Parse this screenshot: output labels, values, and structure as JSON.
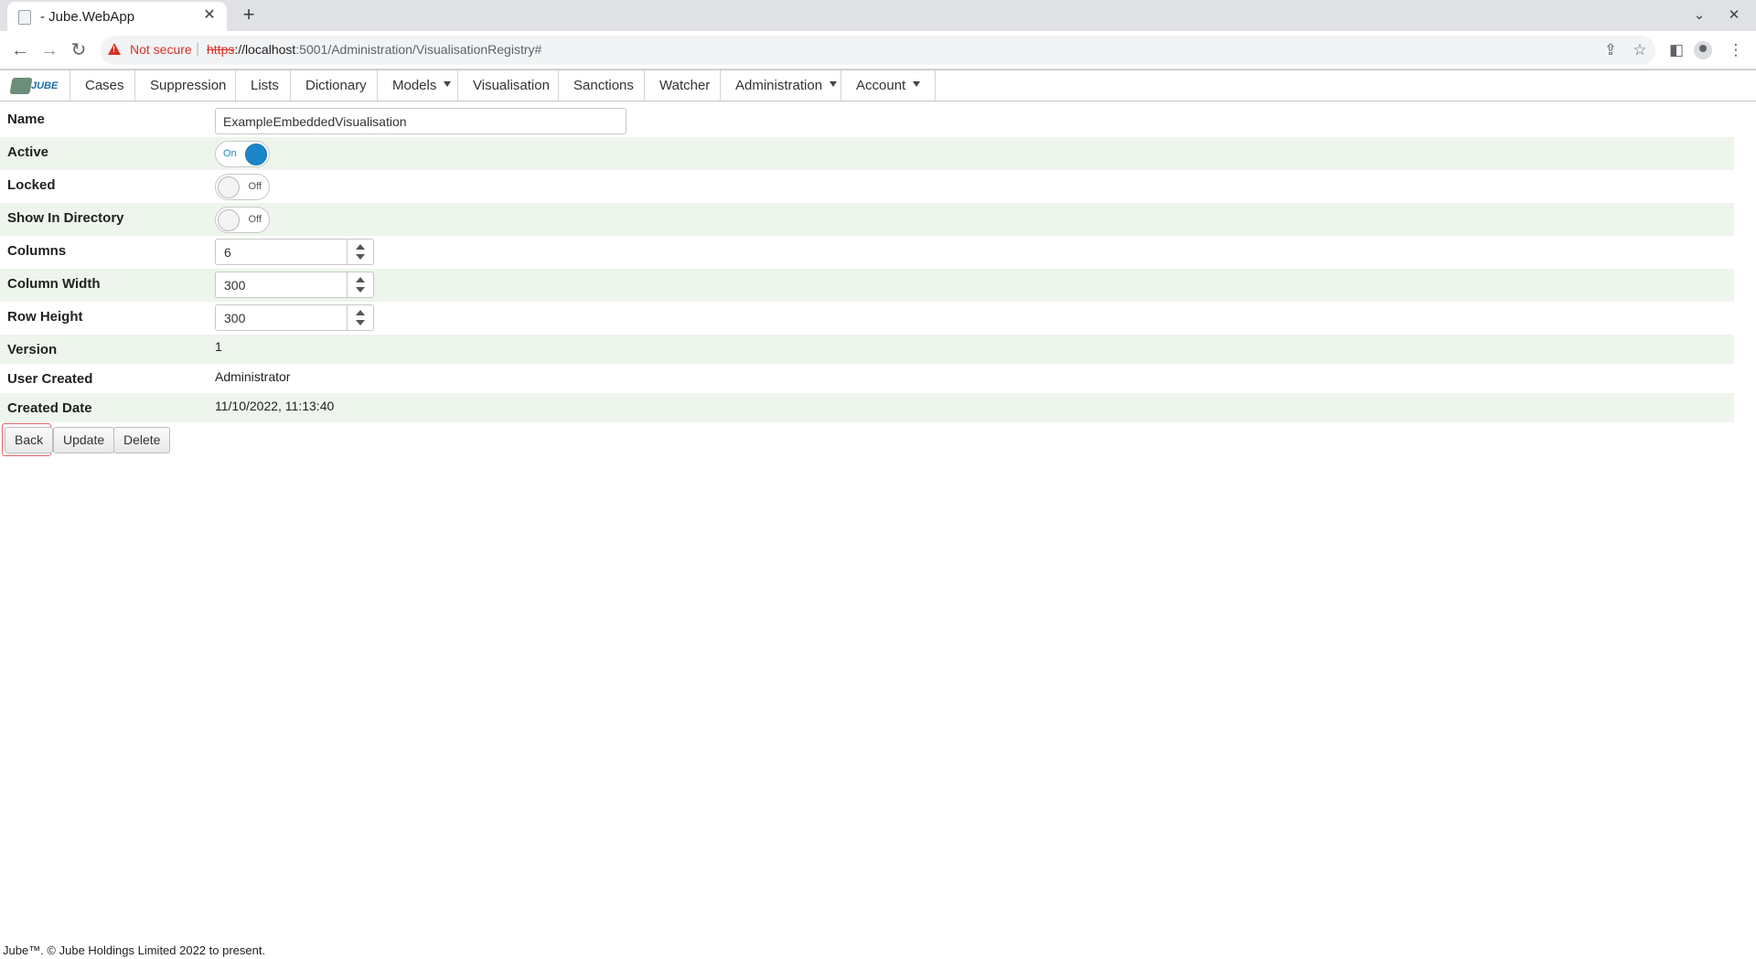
{
  "browser": {
    "tab_title": "- Jube.WebApp",
    "security_label": "Not secure",
    "url_scheme": "https",
    "url_host": "://localhost",
    "url_rest": ":5001/Administration/VisualisationRegistry#"
  },
  "menu": {
    "logo_text": "JUBE",
    "items": [
      "Cases",
      "Suppression",
      "Lists",
      "Dictionary",
      "Models",
      "Visualisation",
      "Sanctions",
      "Watcher",
      "Administration",
      "Account"
    ]
  },
  "form": {
    "name": {
      "label": "Name",
      "value": "ExampleEmbeddedVisualisation"
    },
    "active": {
      "label": "Active",
      "state": "On"
    },
    "locked": {
      "label": "Locked",
      "state": "Off"
    },
    "show_in_directory": {
      "label": "Show In Directory",
      "state": "Off"
    },
    "columns": {
      "label": "Columns",
      "value": "6"
    },
    "column_width": {
      "label": "Column Width",
      "value": "300"
    },
    "row_height": {
      "label": "Row Height",
      "value": "300"
    },
    "version": {
      "label": "Version",
      "value": "1"
    },
    "user_created": {
      "label": "User Created",
      "value": "Administrator"
    },
    "created_date": {
      "label": "Created Date",
      "value": "11/10/2022, 11:13:40"
    }
  },
  "actions": {
    "back": "Back",
    "update": "Update",
    "delete": "Delete"
  },
  "footer": "Jube™. © Jube Holdings Limited 2022 to present.",
  "colors": {
    "row_alt": "#eef5ec",
    "toggle_on": "#1c86c9",
    "warning": "#d93025"
  }
}
